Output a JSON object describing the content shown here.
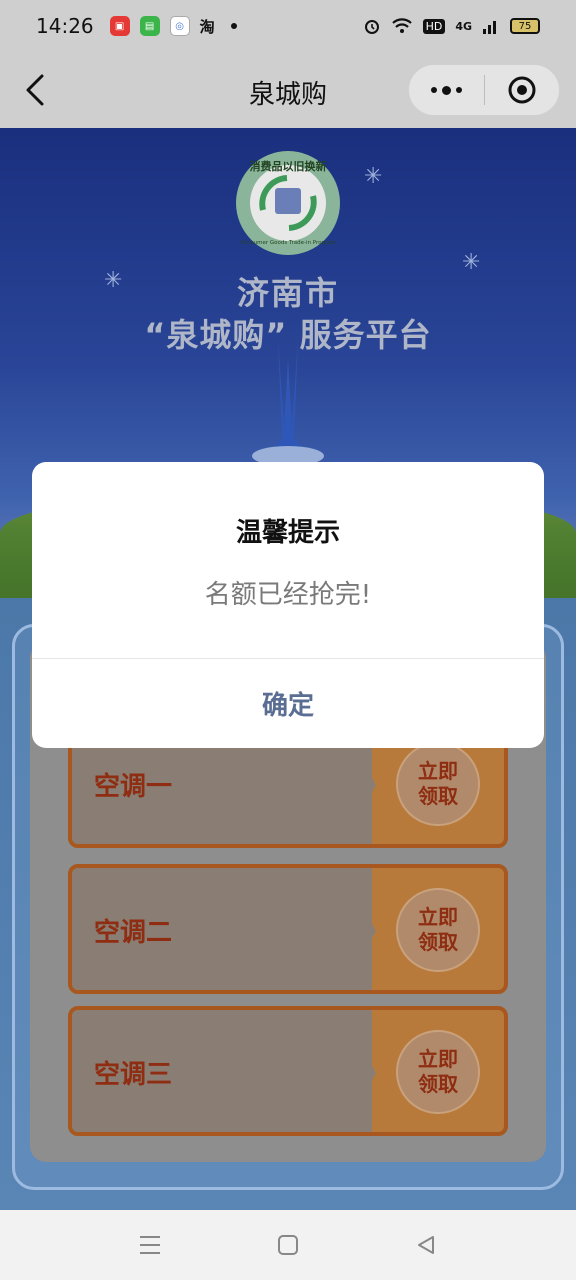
{
  "status_bar": {
    "time": "14:26",
    "notification_apps": [
      "red-app-icon",
      "message-app-icon",
      "blue-app-icon",
      "taobao-icon"
    ],
    "taobao_glyph": "淘",
    "network_type": "4G",
    "hd_label": "HD",
    "battery_level": "75"
  },
  "header": {
    "title": "泉城购",
    "back_icon": "chevron-left-icon",
    "more_icon": "more-dots-icon",
    "close_icon": "target-circle-icon"
  },
  "banner": {
    "logo_text_top": "消费品以旧换新",
    "logo_text_bottom": "Consumer Goods Trade-in Program",
    "city": "济南市",
    "platform": "“泉城购” 服务平台"
  },
  "coupons": [
    {
      "name": "空调一",
      "claim_line1": "立即",
      "claim_line2": "领取"
    },
    {
      "name": "空调二",
      "claim_line1": "立即",
      "claim_line2": "领取"
    },
    {
      "name": "空调三",
      "claim_line1": "立即",
      "claim_line2": "领取"
    }
  ],
  "modal": {
    "title": "温馨提示",
    "message": "名额已经抢完!",
    "confirm_label": "确定"
  },
  "bottom_nav": {
    "items": [
      "menu-icon",
      "home-square-icon",
      "back-triangle-icon"
    ]
  }
}
